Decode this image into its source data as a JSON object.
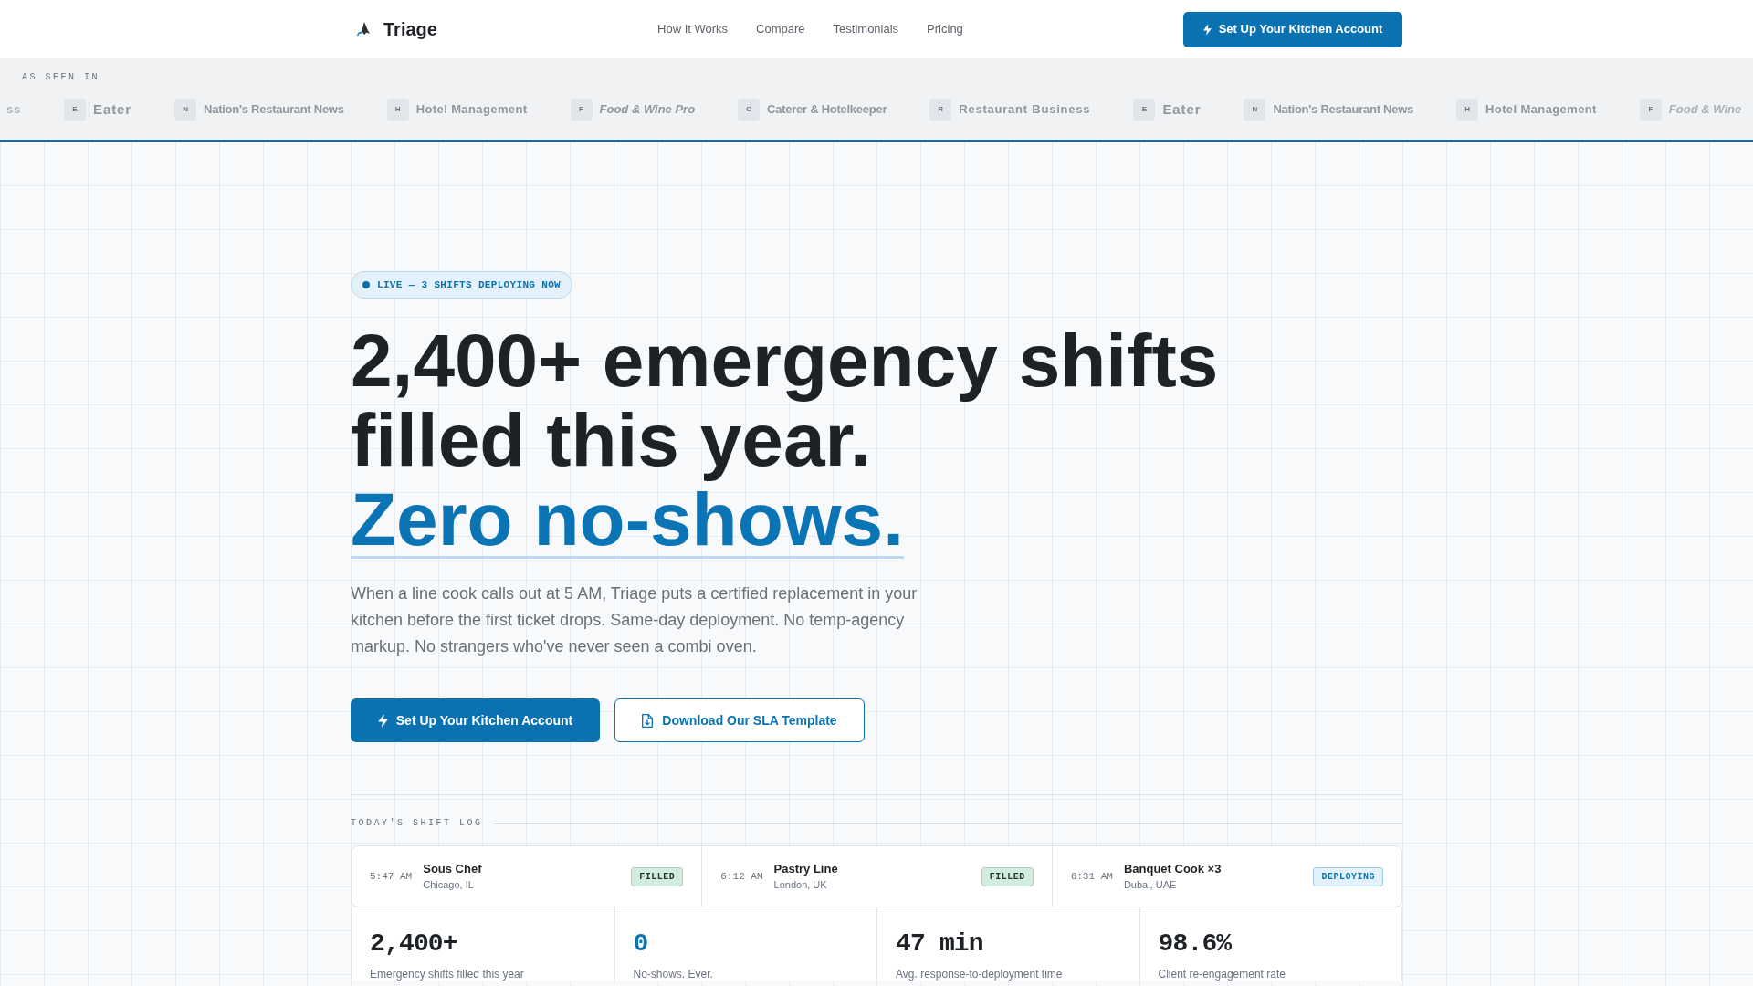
{
  "nav": {
    "brand": "Triage",
    "links": [
      "How It Works",
      "Compare",
      "Testimonials",
      "Pricing"
    ],
    "cta": "Set Up Your Kitchen Account"
  },
  "press": {
    "label": "AS SEEN IN",
    "outlets": [
      {
        "name": "ss",
        "kind": "spaced",
        "faded": true
      },
      {
        "letter": "E",
        "name": "Eater",
        "kind": "display",
        "faded": false
      },
      {
        "letter": "N",
        "name": "Nation's Restaurant News",
        "kind": "condensed",
        "faded": false
      },
      {
        "letter": "H",
        "name": "Hotel Management",
        "kind": "regular",
        "faded": false
      },
      {
        "letter": "F",
        "name": "Food & Wine Pro",
        "kind": "italic",
        "faded": false
      },
      {
        "letter": "C",
        "name": "Caterer & Hotelkeeper",
        "kind": "condensed",
        "faded": false
      },
      {
        "letter": "R",
        "name": "Restaurant Business",
        "kind": "spaced",
        "faded": false
      },
      {
        "letter": "E",
        "name": "Eater",
        "kind": "display",
        "faded": false
      },
      {
        "letter": "N",
        "name": "Nation's Restaurant News",
        "kind": "condensed",
        "faded": false
      },
      {
        "letter": "H",
        "name": "Hotel Management",
        "kind": "regular",
        "faded": false
      },
      {
        "letter": "F",
        "name": "Food & Wine",
        "kind": "italic",
        "faded": true
      }
    ]
  },
  "hero": {
    "badge": "LIVE — 3 SHIFTS DEPLOYING NOW",
    "headline": "2,400+ emergency shifts filled this year.",
    "highlight": "Zero no-shows.",
    "body": "When a line cook calls out at 5 AM, Triage puts a certified replacement in your kitchen before the first ticket drops. Same-day deployment. No temp-agency markup. No strangers who've never seen a combi oven.",
    "primary_button": "Set Up Your Kitchen Account",
    "secondary_button": "Download Our SLA Template"
  },
  "shift_log": {
    "title": "TODAY'S SHIFT LOG",
    "entries": [
      {
        "time": "5:47 AM",
        "role": "Sous Chef",
        "location": "Chicago, IL",
        "status": "FILLED",
        "kind": "filled"
      },
      {
        "time": "6:12 AM",
        "role": "Pastry Line",
        "location": "London, UK",
        "status": "FILLED",
        "kind": "filled"
      },
      {
        "time": "6:31 AM",
        "role": "Banquet Cook ×3",
        "location": "Dubai, UAE",
        "status": "DEPLOYING",
        "kind": "deploying"
      }
    ]
  },
  "stats": [
    {
      "value": "2,400+",
      "label": "Emergency shifts filled this year",
      "highlight": false
    },
    {
      "value": "0",
      "label": "No-shows. Ever.",
      "highlight": true
    },
    {
      "value": "47 min",
      "label": "Avg. response-to-deployment time",
      "highlight": false
    },
    {
      "value": "98.6%",
      "label": "Client re-engagement rate",
      "highlight": false
    }
  ]
}
